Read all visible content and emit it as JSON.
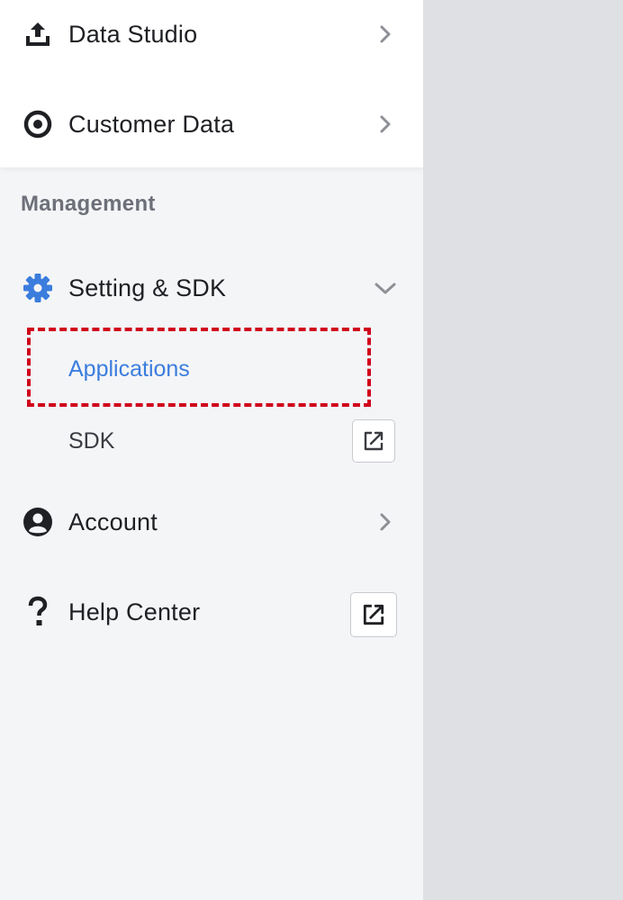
{
  "nav": {
    "data_studio": {
      "label": "Data Studio",
      "icon": "upload-icon"
    },
    "customer_data": {
      "label": "Customer Data",
      "icon": "target-icon"
    }
  },
  "management": {
    "title": "Management",
    "setting_sdk": {
      "label": "Setting & SDK",
      "icon": "gear-icon",
      "expanded": true,
      "children": {
        "applications": {
          "label": "Applications",
          "active": true
        },
        "sdk": {
          "label": "SDK",
          "external": true
        }
      }
    },
    "account": {
      "label": "Account",
      "icon": "user-circle-icon"
    },
    "help_center": {
      "label": "Help Center",
      "icon": "question-icon",
      "external": true
    }
  },
  "colors": {
    "accent": "#3b7ddd",
    "highlight": "#d0021b",
    "text": "#1f2024",
    "muted": "#6d7079"
  }
}
